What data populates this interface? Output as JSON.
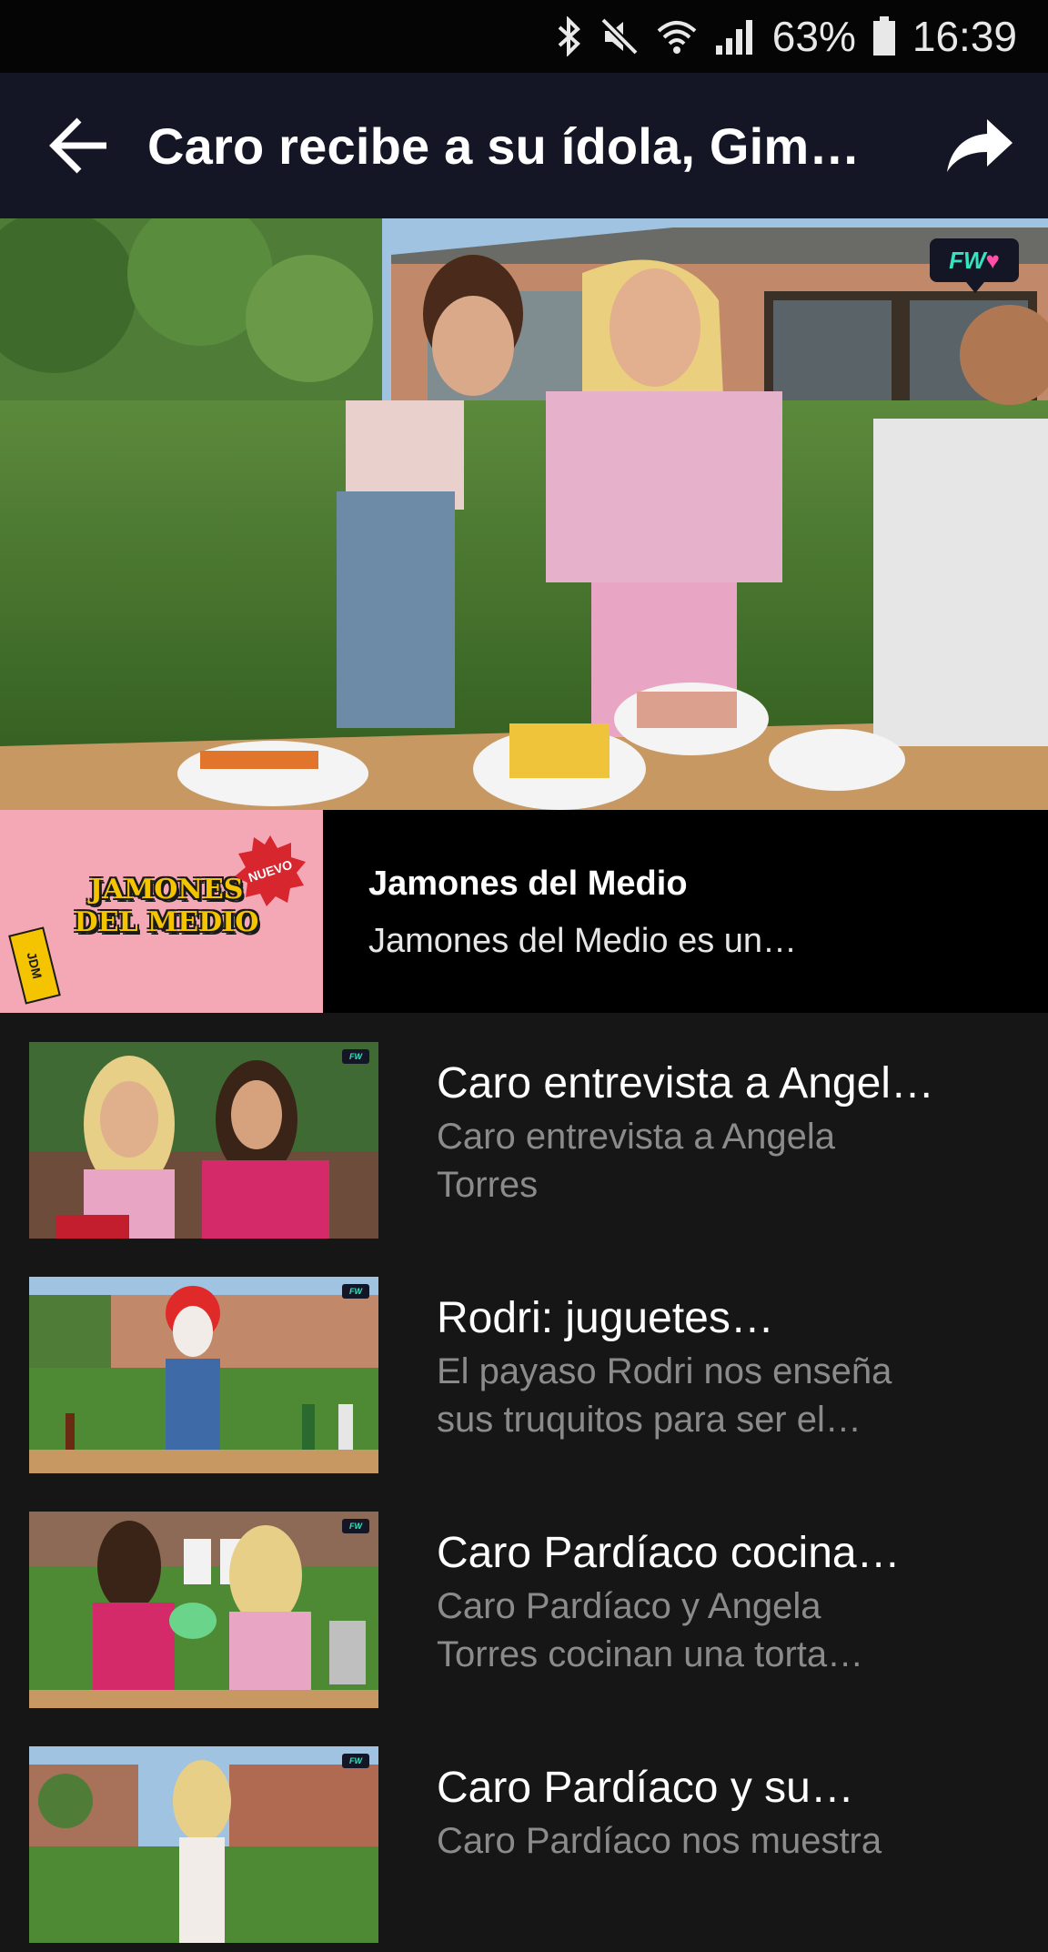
{
  "status_bar": {
    "battery": "63%",
    "time": "16:39",
    "icons": [
      "bluetooth-icon",
      "mute-icon",
      "wifi-icon",
      "signal-icon",
      "battery-icon"
    ]
  },
  "header": {
    "title": "Caro recibe a su ídola, Gim…",
    "back_icon": "back-arrow-icon",
    "share_icon": "share-icon"
  },
  "hero": {
    "badge": "FW"
  },
  "channel": {
    "logo_lines": [
      "JAMONES",
      "DEL MEDIO"
    ],
    "logo_badge": "NUEVO",
    "logo_tag": "JDM",
    "name": "Jamones del Medio",
    "description": "Jamones del Medio es un…"
  },
  "videos": [
    {
      "title": "Caro entrevista a Angel…",
      "description_lines": [
        "Caro entrevista a Angela",
        "Torres"
      ]
    },
    {
      "title": "Rodri: juguetes…",
      "description_lines": [
        "El payaso Rodri nos enseña",
        "sus truquitos para ser el…"
      ]
    },
    {
      "title": "Caro Pardíaco cocina…",
      "description_lines": [
        "Caro Pardíaco y Angela",
        "Torres cocinan una torta…"
      ]
    },
    {
      "title": "Caro Pardíaco y su…",
      "description_lines": [
        "Caro Pardíaco nos muestra"
      ]
    }
  ],
  "colors": {
    "app_bar": "#141625",
    "status_bar": "#050505",
    "list_background": "#161616",
    "channel_row": "#000000",
    "accent": "#36e3c0"
  }
}
